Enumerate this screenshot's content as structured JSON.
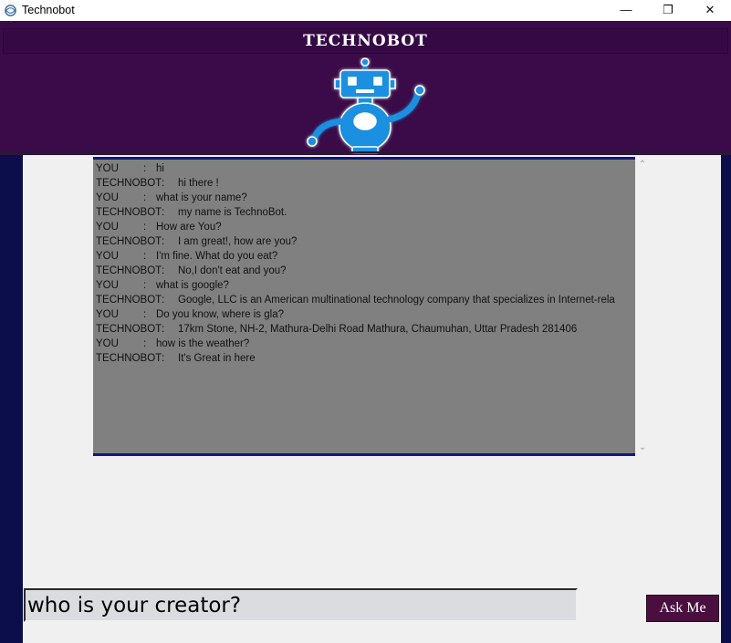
{
  "window": {
    "title": "Technobot",
    "minimize_icon": "—",
    "maximize_icon": "❐",
    "close_icon": "✕"
  },
  "header": {
    "brand": "TECHNOBOT"
  },
  "chat": {
    "messages": [
      {
        "speaker": "YOU",
        "sep": ":",
        "text": "hi"
      },
      {
        "speaker": "TECHNOBOT",
        "sep": ":",
        "text": "hi there !"
      },
      {
        "speaker": "YOU",
        "sep": ":",
        "text": "what is your name?"
      },
      {
        "speaker": "TECHNOBOT",
        "sep": ":",
        "text": "my name is TechnoBot."
      },
      {
        "speaker": "YOU",
        "sep": ":",
        "text": "How are You?"
      },
      {
        "speaker": "TECHNOBOT",
        "sep": ":",
        "text": "I am great!, how are you?"
      },
      {
        "speaker": "YOU",
        "sep": ":",
        "text": "I'm fine. What do you eat?"
      },
      {
        "speaker": "TECHNOBOT",
        "sep": ":",
        "text": "No,I don't eat and you?"
      },
      {
        "speaker": "YOU",
        "sep": ":",
        "text": "what is google?"
      },
      {
        "speaker": "TECHNOBOT",
        "sep": ":",
        "text": "Google, LLC is an American multinational technology company that specializes in Internet-rela"
      },
      {
        "speaker": "YOU",
        "sep": ":",
        "text": "Do you know, where is gla?"
      },
      {
        "speaker": "TECHNOBOT",
        "sep": ":",
        "text": "17km Stone, NH-2, Mathura-Delhi Road Mathura, Chaumuhan, Uttar Pradesh 281406"
      },
      {
        "speaker": "YOU",
        "sep": ":",
        "text": "how is the weather?"
      },
      {
        "speaker": "TECHNOBOT",
        "sep": ":",
        "text": "It's Great in here"
      }
    ],
    "scroll_up_icon": "⌃",
    "scroll_down_icon": "⌄"
  },
  "input": {
    "value": "who is your creator?"
  },
  "ask_button": {
    "label": "Ask Me"
  },
  "colors": {
    "header_bg": "#3a0b48",
    "side_strip": "#0b0e4a",
    "chat_bg": "#808080",
    "chat_border": "#0b1a7a",
    "button_bg": "#4a0f3f",
    "robot_blue": "#1e90e0"
  }
}
